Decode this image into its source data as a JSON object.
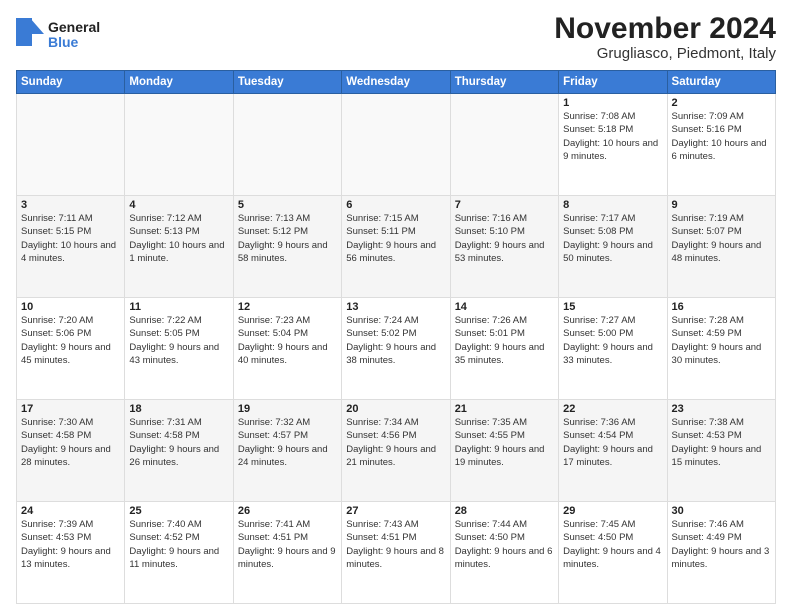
{
  "logo": {
    "general": "General",
    "blue": "Blue"
  },
  "title": "November 2024",
  "subtitle": "Grugliasco, Piedmont, Italy",
  "weekdays": [
    "Sunday",
    "Monday",
    "Tuesday",
    "Wednesday",
    "Thursday",
    "Friday",
    "Saturday"
  ],
  "weeks": [
    [
      {
        "day": "",
        "info": ""
      },
      {
        "day": "",
        "info": ""
      },
      {
        "day": "",
        "info": ""
      },
      {
        "day": "",
        "info": ""
      },
      {
        "day": "",
        "info": ""
      },
      {
        "day": "1",
        "info": "Sunrise: 7:08 AM\nSunset: 5:18 PM\nDaylight: 10 hours and 9 minutes."
      },
      {
        "day": "2",
        "info": "Sunrise: 7:09 AM\nSunset: 5:16 PM\nDaylight: 10 hours and 6 minutes."
      }
    ],
    [
      {
        "day": "3",
        "info": "Sunrise: 7:11 AM\nSunset: 5:15 PM\nDaylight: 10 hours and 4 minutes."
      },
      {
        "day": "4",
        "info": "Sunrise: 7:12 AM\nSunset: 5:13 PM\nDaylight: 10 hours and 1 minute."
      },
      {
        "day": "5",
        "info": "Sunrise: 7:13 AM\nSunset: 5:12 PM\nDaylight: 9 hours and 58 minutes."
      },
      {
        "day": "6",
        "info": "Sunrise: 7:15 AM\nSunset: 5:11 PM\nDaylight: 9 hours and 56 minutes."
      },
      {
        "day": "7",
        "info": "Sunrise: 7:16 AM\nSunset: 5:10 PM\nDaylight: 9 hours and 53 minutes."
      },
      {
        "day": "8",
        "info": "Sunrise: 7:17 AM\nSunset: 5:08 PM\nDaylight: 9 hours and 50 minutes."
      },
      {
        "day": "9",
        "info": "Sunrise: 7:19 AM\nSunset: 5:07 PM\nDaylight: 9 hours and 48 minutes."
      }
    ],
    [
      {
        "day": "10",
        "info": "Sunrise: 7:20 AM\nSunset: 5:06 PM\nDaylight: 9 hours and 45 minutes."
      },
      {
        "day": "11",
        "info": "Sunrise: 7:22 AM\nSunset: 5:05 PM\nDaylight: 9 hours and 43 minutes."
      },
      {
        "day": "12",
        "info": "Sunrise: 7:23 AM\nSunset: 5:04 PM\nDaylight: 9 hours and 40 minutes."
      },
      {
        "day": "13",
        "info": "Sunrise: 7:24 AM\nSunset: 5:02 PM\nDaylight: 9 hours and 38 minutes."
      },
      {
        "day": "14",
        "info": "Sunrise: 7:26 AM\nSunset: 5:01 PM\nDaylight: 9 hours and 35 minutes."
      },
      {
        "day": "15",
        "info": "Sunrise: 7:27 AM\nSunset: 5:00 PM\nDaylight: 9 hours and 33 minutes."
      },
      {
        "day": "16",
        "info": "Sunrise: 7:28 AM\nSunset: 4:59 PM\nDaylight: 9 hours and 30 minutes."
      }
    ],
    [
      {
        "day": "17",
        "info": "Sunrise: 7:30 AM\nSunset: 4:58 PM\nDaylight: 9 hours and 28 minutes."
      },
      {
        "day": "18",
        "info": "Sunrise: 7:31 AM\nSunset: 4:58 PM\nDaylight: 9 hours and 26 minutes."
      },
      {
        "day": "19",
        "info": "Sunrise: 7:32 AM\nSunset: 4:57 PM\nDaylight: 9 hours and 24 minutes."
      },
      {
        "day": "20",
        "info": "Sunrise: 7:34 AM\nSunset: 4:56 PM\nDaylight: 9 hours and 21 minutes."
      },
      {
        "day": "21",
        "info": "Sunrise: 7:35 AM\nSunset: 4:55 PM\nDaylight: 9 hours and 19 minutes."
      },
      {
        "day": "22",
        "info": "Sunrise: 7:36 AM\nSunset: 4:54 PM\nDaylight: 9 hours and 17 minutes."
      },
      {
        "day": "23",
        "info": "Sunrise: 7:38 AM\nSunset: 4:53 PM\nDaylight: 9 hours and 15 minutes."
      }
    ],
    [
      {
        "day": "24",
        "info": "Sunrise: 7:39 AM\nSunset: 4:53 PM\nDaylight: 9 hours and 13 minutes."
      },
      {
        "day": "25",
        "info": "Sunrise: 7:40 AM\nSunset: 4:52 PM\nDaylight: 9 hours and 11 minutes."
      },
      {
        "day": "26",
        "info": "Sunrise: 7:41 AM\nSunset: 4:51 PM\nDaylight: 9 hours and 9 minutes."
      },
      {
        "day": "27",
        "info": "Sunrise: 7:43 AM\nSunset: 4:51 PM\nDaylight: 9 hours and 8 minutes."
      },
      {
        "day": "28",
        "info": "Sunrise: 7:44 AM\nSunset: 4:50 PM\nDaylight: 9 hours and 6 minutes."
      },
      {
        "day": "29",
        "info": "Sunrise: 7:45 AM\nSunset: 4:50 PM\nDaylight: 9 hours and 4 minutes."
      },
      {
        "day": "30",
        "info": "Sunrise: 7:46 AM\nSunset: 4:49 PM\nDaylight: 9 hours and 3 minutes."
      }
    ]
  ]
}
